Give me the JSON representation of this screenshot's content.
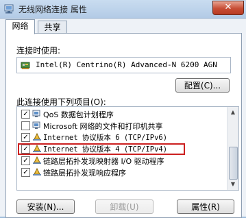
{
  "window": {
    "title": "无线网络连接 属性",
    "close_glyph": "✕"
  },
  "tabs": [
    {
      "label": "网络",
      "active": true
    },
    {
      "label": "共享",
      "active": false
    }
  ],
  "connect_using_label": "连接时使用:",
  "adapter_name": "Intel(R) Centrino(R) Advanced-N 6200 AGN",
  "configure_button": "配置(C)...",
  "items_label": "此连接使用下列项目(O):",
  "items": [
    {
      "label": "QoS 数据包计划程序",
      "checked": true,
      "icon": "network-service-icon"
    },
    {
      "label": "Microsoft 网络的文件和打印机共享",
      "checked": false,
      "icon": "network-service-icon"
    },
    {
      "label": "Internet 协议版本 6 (TCP/IPv6)",
      "checked": true,
      "icon": "network-protocol-icon"
    },
    {
      "label": "Internet 协议版本 4 (TCP/IPv4)",
      "checked": true,
      "icon": "network-protocol-icon",
      "highlighted": true
    },
    {
      "label": "链路层拓扑发现映射器 I/O 驱动程序",
      "checked": true,
      "icon": "network-protocol-icon"
    },
    {
      "label": "链路层拓扑发现响应程序",
      "checked": true,
      "icon": "network-protocol-icon"
    }
  ],
  "buttons": {
    "install": "安装(N)...",
    "uninstall": "卸载(U)",
    "properties": "属性(R)"
  },
  "colors": {
    "highlight_border": "#cc2020",
    "close_button": "#c74d35"
  }
}
